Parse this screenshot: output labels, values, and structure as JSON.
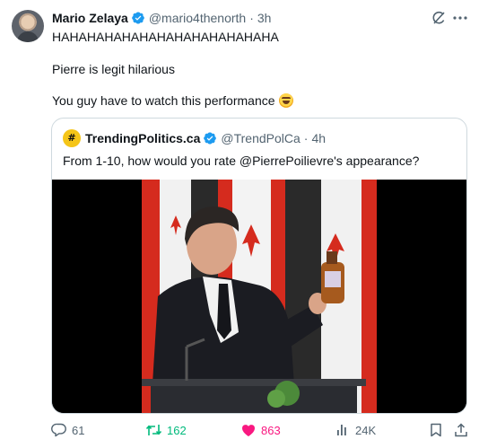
{
  "author": {
    "name": "Mario Zelaya",
    "handle": "@mario4thenorth",
    "time": "3h"
  },
  "tweet": {
    "line1": "HAHAHAHAHAHAHAHAHAHAHAHAHA",
    "line2": "Pierre is legit hilarious",
    "line3": "You guy have to watch this performance"
  },
  "quote": {
    "logo_text": "#",
    "name": "TrendingPolitics.ca",
    "handle": "@TrendPolCa",
    "time": "4h",
    "text": "From 1-10, how would you rate @PierrePoilievre's appearance?"
  },
  "actions": {
    "replies": "61",
    "retweets": "162",
    "likes": "863",
    "views": "24K"
  },
  "colors": {
    "verified": "#1d9bf0",
    "retweet_active": "#00ba7c",
    "like_active": "#f91880",
    "muted": "#536471",
    "flag_red": "#d52b1e"
  },
  "icons": [
    "verified-badge-icon",
    "grok-icon",
    "more-icon",
    "rofl-emoji",
    "reply-icon",
    "retweet-icon",
    "like-heart-icon",
    "views-icon",
    "bookmark-icon",
    "share-icon"
  ]
}
